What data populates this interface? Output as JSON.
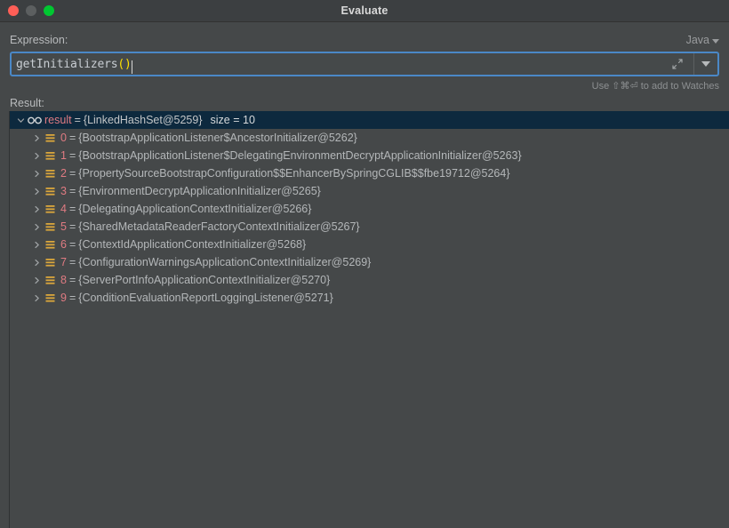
{
  "window": {
    "title": "Evaluate",
    "traffic_lights": [
      "close-button",
      "minimize-button",
      "zoom-button"
    ]
  },
  "expression": {
    "label": "Expression:",
    "language": "Java",
    "value": "getInitializers()",
    "code_prefix": "getInitializers",
    "code_parens": "()",
    "expand_icon": "expand-icon",
    "dropdown_icon": "chevron-down-icon",
    "hint": "Use ⇧⌘⏎ to add to Watches"
  },
  "result": {
    "label": "Result:",
    "root": {
      "name": "result",
      "equals": "=",
      "value": "{LinkedHashSet@5259}",
      "size": "size = 10",
      "expanded": true,
      "selected": true,
      "icon": "glasses-icon"
    },
    "children": [
      {
        "name": "0",
        "equals": "=",
        "value": "{BootstrapApplicationListener$AncestorInitializer@5262}",
        "icon": "list-icon"
      },
      {
        "name": "1",
        "equals": "=",
        "value": "{BootstrapApplicationListener$DelegatingEnvironmentDecryptApplicationInitializer@5263}",
        "icon": "list-icon"
      },
      {
        "name": "2",
        "equals": "=",
        "value": "{PropertySourceBootstrapConfiguration$$EnhancerBySpringCGLIB$$fbe19712@5264}",
        "icon": "list-icon"
      },
      {
        "name": "3",
        "equals": "=",
        "value": "{EnvironmentDecryptApplicationInitializer@5265}",
        "icon": "list-icon"
      },
      {
        "name": "4",
        "equals": "=",
        "value": "{DelegatingApplicationContextInitializer@5266}",
        "icon": "list-icon"
      },
      {
        "name": "5",
        "equals": "=",
        "value": "{SharedMetadataReaderFactoryContextInitializer@5267}",
        "icon": "list-icon"
      },
      {
        "name": "6",
        "equals": "=",
        "value": "{ContextIdApplicationContextInitializer@5268}",
        "icon": "list-icon"
      },
      {
        "name": "7",
        "equals": "=",
        "value": "{ConfigurationWarningsApplicationContextInitializer@5269}",
        "icon": "list-icon"
      },
      {
        "name": "8",
        "equals": "=",
        "value": "{ServerPortInfoApplicationContextInitializer@5270}",
        "icon": "list-icon"
      },
      {
        "name": "9",
        "equals": "=",
        "value": "{ConditionEvaluationReportLoggingListener@5271}",
        "icon": "list-icon"
      }
    ]
  },
  "colors": {
    "window_bg": "#454849",
    "titlebar_bg": "#3c3f41",
    "selection_bg": "#0d293e",
    "field_border": "#4a88c7",
    "node_name": "#e07b82",
    "icon_gold": "#d9a63c",
    "paren_yellow": "#ffe000"
  }
}
